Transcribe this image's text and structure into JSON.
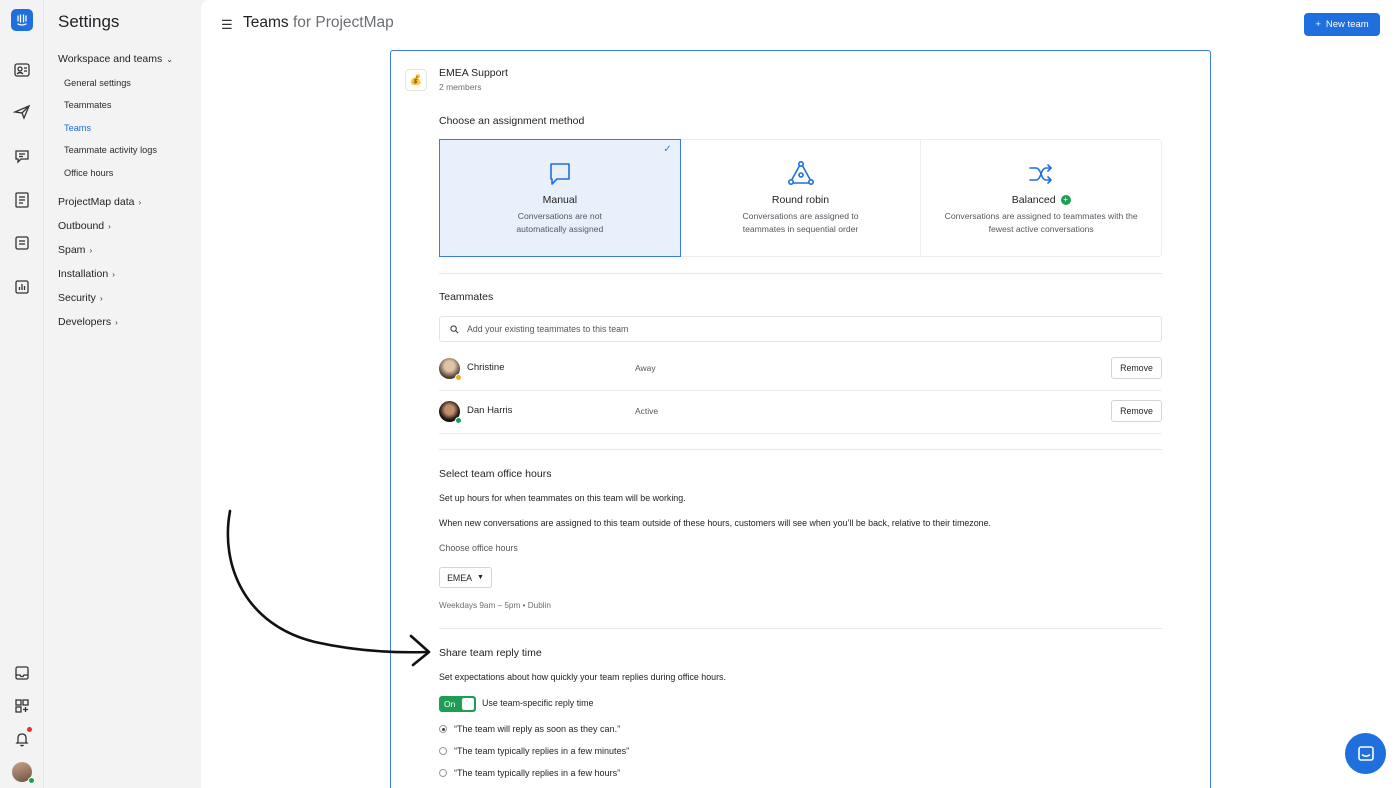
{
  "rail": {
    "icons": [
      "logo-icon",
      "contacts-icon",
      "outbound-icon",
      "chat-icon",
      "articles-icon",
      "inbox-icon",
      "reports-icon",
      "messages-icon",
      "apps-icon",
      "notifications-icon",
      "avatar"
    ]
  },
  "nav": {
    "title": "Settings",
    "workspace_group": "Workspace and teams",
    "workspace_items": [
      "General settings",
      "Teammates",
      "Teams",
      "Teammate activity logs",
      "Office hours"
    ],
    "groups": [
      "ProjectMap data",
      "Outbound",
      "Spam",
      "Installation",
      "Security",
      "Developers"
    ]
  },
  "header": {
    "title": "Teams",
    "subtitle": "for ProjectMap",
    "new_team_label": "New team"
  },
  "team": {
    "emoji": "💰",
    "name": "EMEA Support",
    "members": "2 members"
  },
  "assignment": {
    "title": "Choose an assignment method",
    "methods": [
      {
        "name": "Manual",
        "desc": "Conversations are not automatically assigned",
        "selected": true
      },
      {
        "name": "Round robin",
        "desc": "Conversations are assigned to teammates in sequential order",
        "selected": false
      },
      {
        "name": "Balanced",
        "desc": "Conversations are assigned to teammates with the fewest active conversations",
        "selected": false
      }
    ]
  },
  "teammates": {
    "title": "Teammates",
    "search_placeholder": "Add your existing teammates to this team",
    "list": [
      {
        "name": "Christine",
        "status": "Away",
        "action": "Remove"
      },
      {
        "name": "Dan Harris",
        "status": "Active",
        "action": "Remove"
      }
    ]
  },
  "office_hours": {
    "title": "Select team office hours",
    "line1": "Set up hours for when teammates on this team will be working.",
    "line2": "When new conversations are assigned to this team outside of these hours, customers will see when you’ll be back, relative to their timezone.",
    "choose_label": "Choose office hours",
    "selected": "EMEA",
    "schedule": "Weekdays 9am – 5pm • Dublin"
  },
  "reply_time": {
    "title": "Share team reply time",
    "desc": "Set expectations about how quickly your team replies during office hours.",
    "toggle_label": "On",
    "toggle_desc": "Use team-specific reply time",
    "options": [
      "“The team will reply as soon as they can.”",
      "“The team typically replies in a few minutes”",
      "“The team typically replies in a few hours”"
    ],
    "selected_index": 0
  },
  "colors": {
    "accent": "#1f6fde",
    "selected_bg": "#e8f0fc",
    "success": "#1e9e55"
  }
}
